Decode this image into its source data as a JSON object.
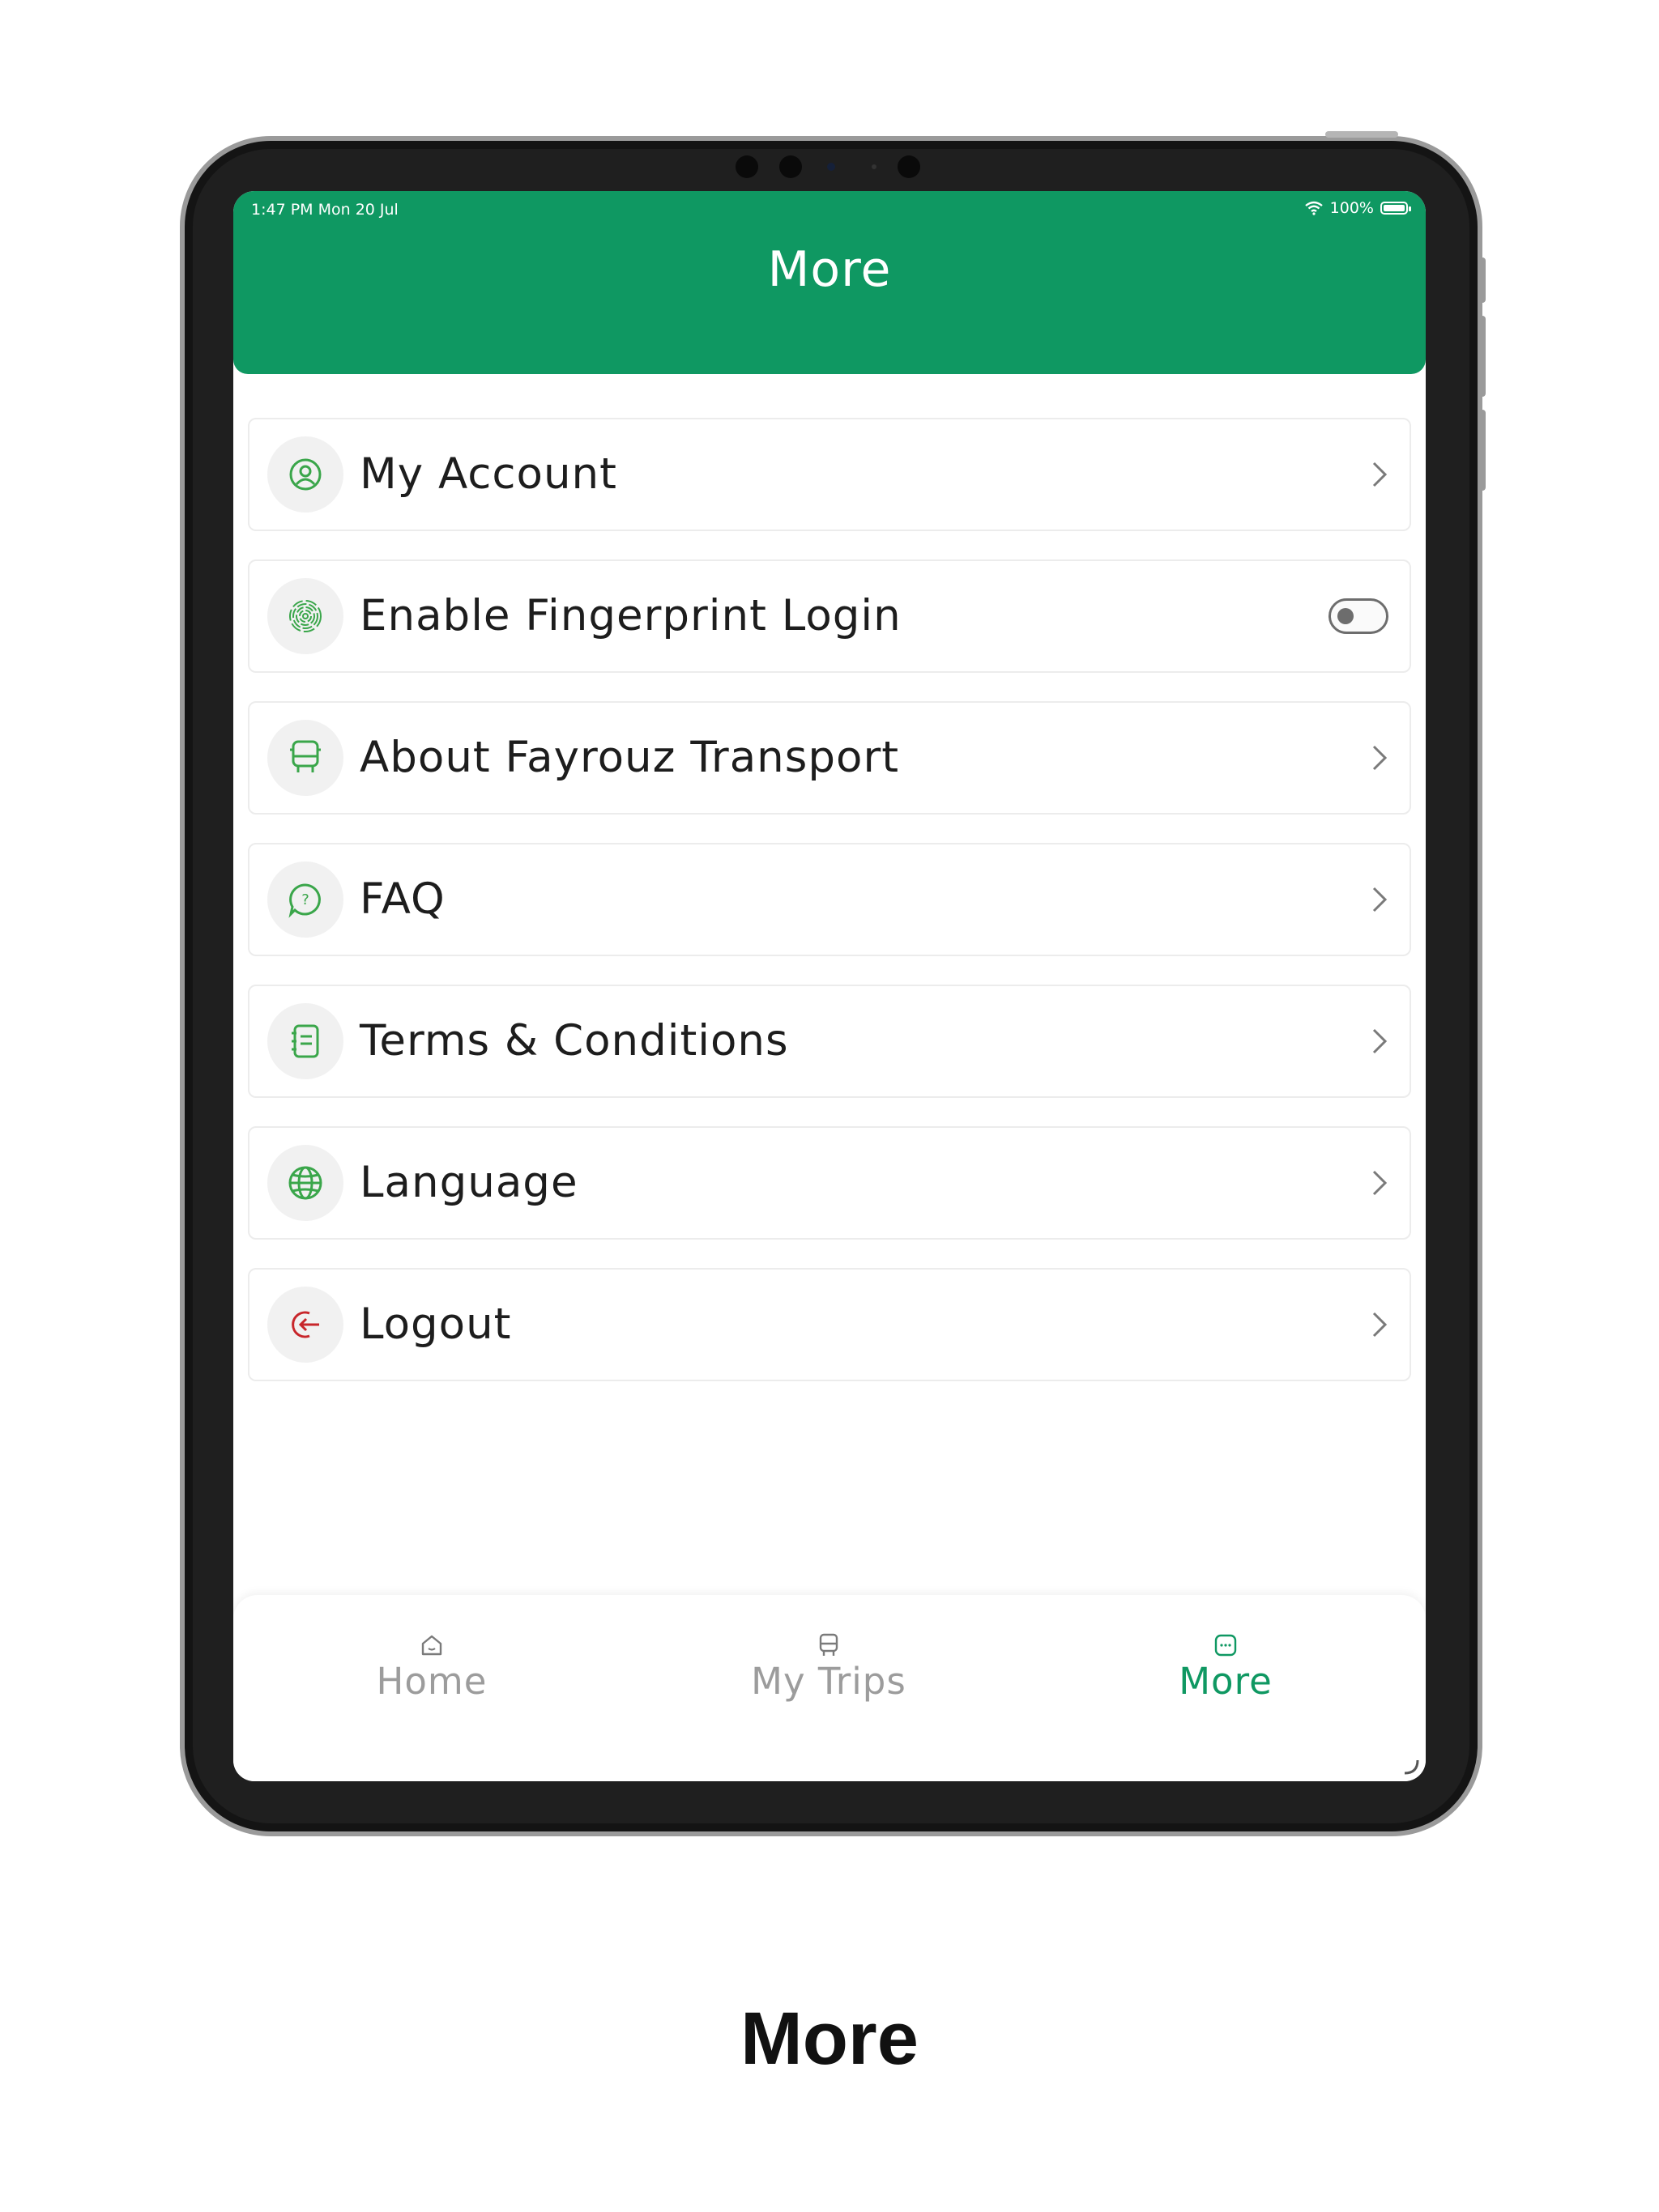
{
  "status_bar": {
    "time": "1:47 PM  Mon 20 Jul",
    "battery": "100%"
  },
  "header": {
    "title": "More"
  },
  "menu": {
    "items": [
      {
        "label": "My Account",
        "icon": "user-circle-icon"
      },
      {
        "label": "Enable Fingerprint Login",
        "icon": "fingerprint-icon",
        "toggle_on": false
      },
      {
        "label": "About Fayrouz Transport",
        "icon": "bus-icon"
      },
      {
        "label": "FAQ",
        "icon": "question-bubble-icon"
      },
      {
        "label": "Terms & Conditions",
        "icon": "document-icon"
      },
      {
        "label": "Language",
        "icon": "globe-icon"
      },
      {
        "label": "Logout",
        "icon": "logout-icon"
      }
    ]
  },
  "tabbar": {
    "tabs": [
      {
        "label": "Home",
        "icon": "home-icon",
        "active": false
      },
      {
        "label": "My Trips",
        "icon": "bus-icon",
        "active": false
      },
      {
        "label": "More",
        "icon": "more-icon",
        "active": true
      }
    ]
  },
  "caption": "More",
  "colors": {
    "brand_green": "#0f9862",
    "icon_green": "#3aa64a",
    "logout_red": "#c8262b",
    "inactive_gray": "#9c9c9c"
  }
}
